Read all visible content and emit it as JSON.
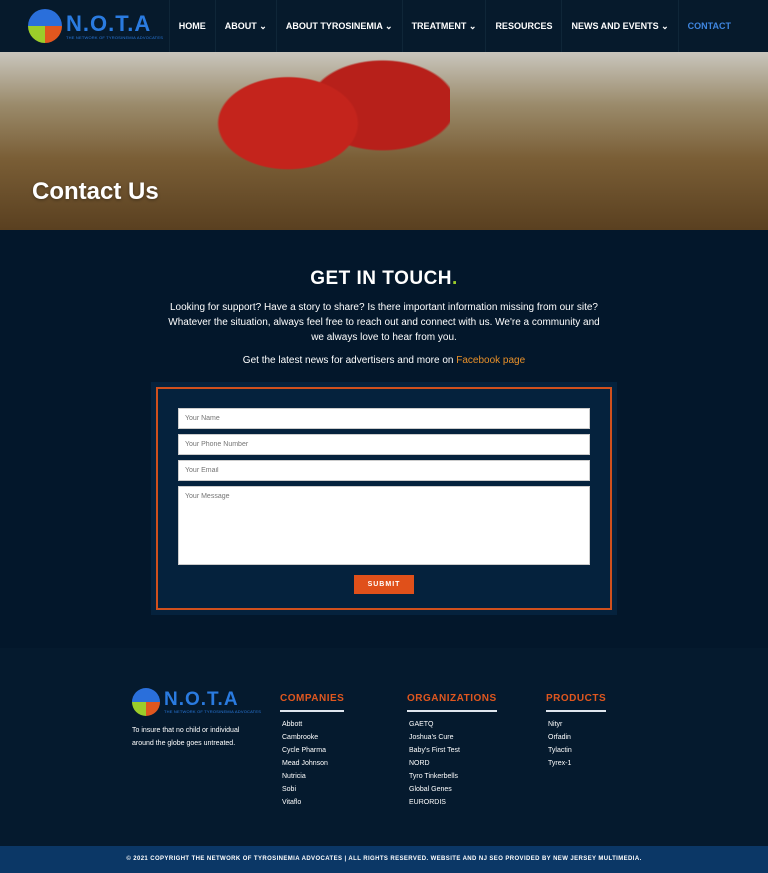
{
  "brand": {
    "name": "N.O.T.A",
    "tagline": "THE NETWORK OF TYROSINEMIA ADVOCATES"
  },
  "nav": {
    "items": [
      {
        "label": "HOME"
      },
      {
        "label": "ABOUT ⌄"
      },
      {
        "label": "ABOUT TYROSINEMIA ⌄"
      },
      {
        "label": "TREATMENT ⌄"
      },
      {
        "label": "RESOURCES"
      },
      {
        "label": "NEWS AND EVENTS ⌄"
      },
      {
        "label": "CONTACT"
      }
    ],
    "active": "CONTACT"
  },
  "hero": {
    "title": "Contact Us"
  },
  "touch": {
    "title": "GET IN TOUCH",
    "dot": ".",
    "body": "Looking for support? Have a story to share? Is there important information missing from our site? Whatever the situation, always feel free to reach out and connect with us. We're a community and we always love to hear from you.",
    "fb_prefix": "Get the latest news for advertisers and more on ",
    "fb_link": "Facebook page"
  },
  "form": {
    "name_placeholder": "Your Name",
    "phone_placeholder": "Your Phone Number",
    "email_placeholder": "Your Email",
    "message_placeholder": "Your Message",
    "submit": "SUBMIT"
  },
  "footer": {
    "tagline": "To insure that no child or individual around the globe goes untreated.",
    "companies": {
      "title": "COMPANIES",
      "items": [
        "Abbott",
        "Cambrooke",
        "Cycle Pharma",
        "Mead Johnson",
        "Nutricia",
        "Sobi",
        "Vitaflo"
      ]
    },
    "organizations": {
      "title": "ORGANIZATIONS",
      "items": [
        "GAETQ",
        "Joshua's Cure",
        "Baby's First Test",
        "NORD",
        "Tyro Tinkerbells",
        "Global Genes",
        "EURORDIS"
      ]
    },
    "products": {
      "title": "PRODUCTS",
      "items": [
        "Nityr",
        "Orfadin",
        "Tylactin",
        "Tyrex-1"
      ]
    }
  },
  "copyright": {
    "text1": "© 2021 COPYRIGHT THE NETWORK OF TYROSINEMIA ADVOCATES | ALL RIGHTS RESERVED. ",
    "website": "WEBSITE",
    "and": " AND ",
    "seo": "NJ SEO",
    "provided": " PROVIDED BY ",
    "company": "NEW JERSEY MULTIMEDIA",
    "end": "."
  },
  "colors": {
    "accent": "#e0571f",
    "brand": "#2a7be0",
    "background": "#03172b"
  }
}
